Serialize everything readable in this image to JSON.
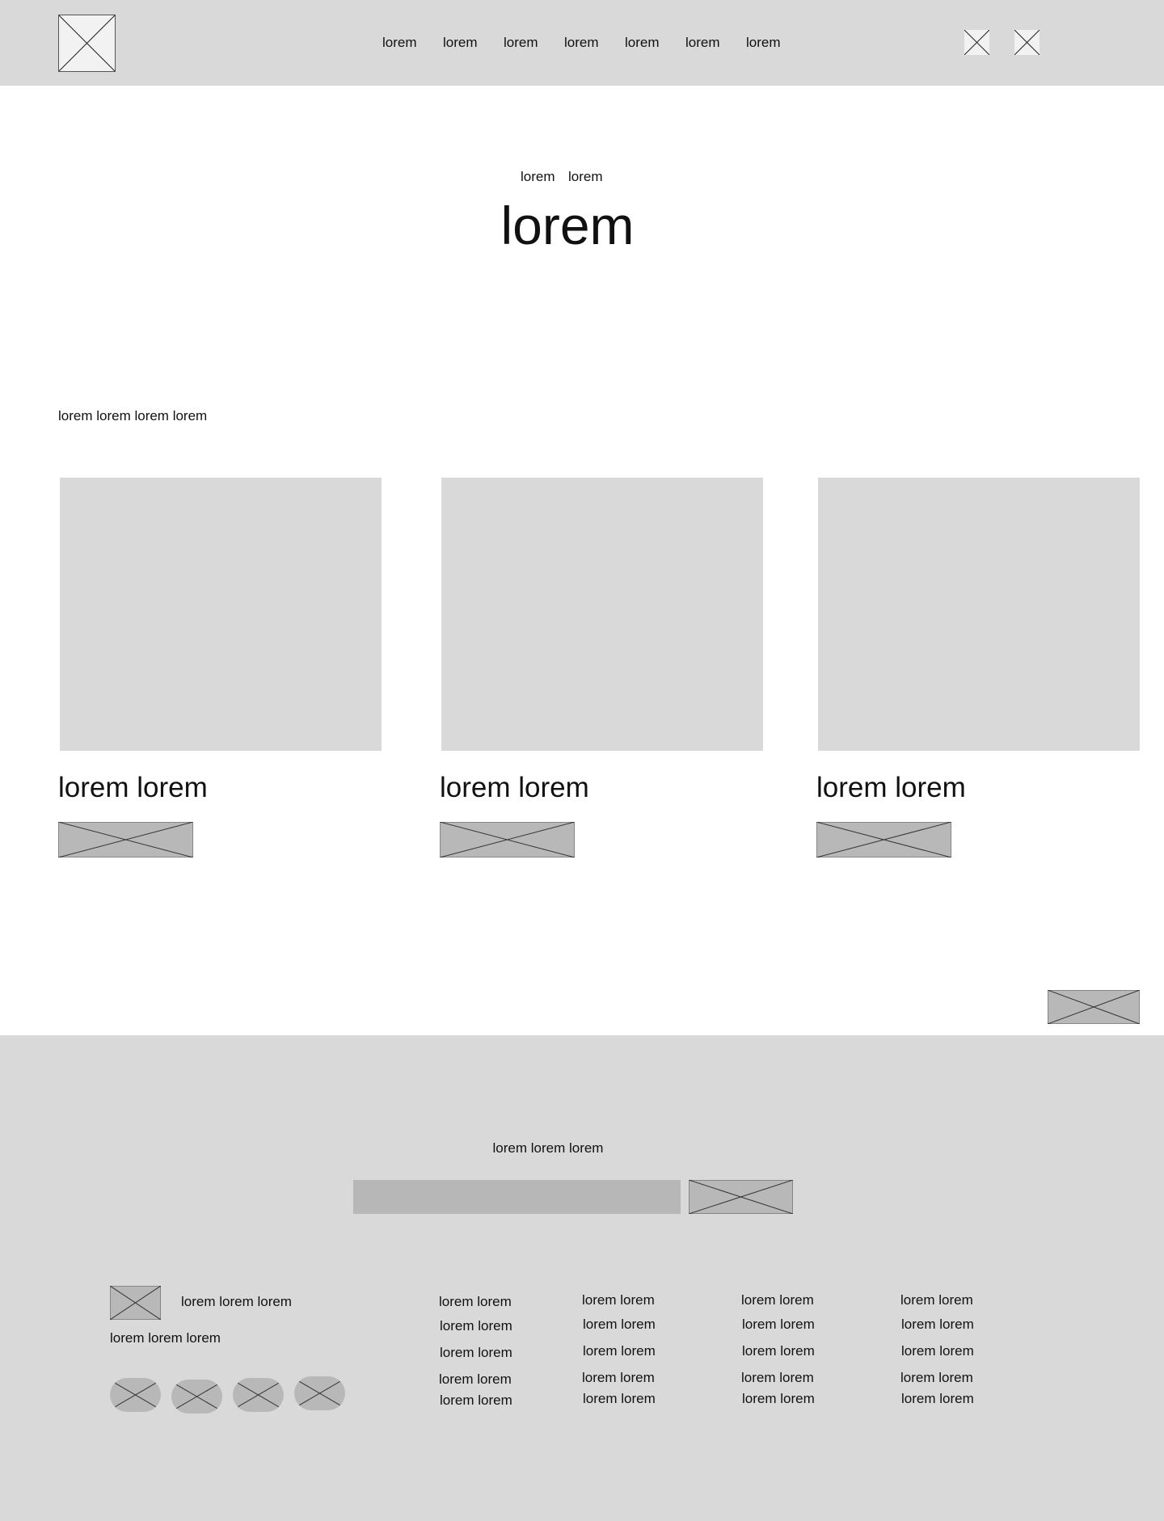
{
  "header": {
    "nav": [
      "lorem",
      "lorem",
      "lorem",
      "lorem",
      "lorem",
      "lorem",
      "lorem"
    ]
  },
  "hero": {
    "breadcrumb": [
      "lorem",
      "lorem"
    ],
    "title": "lorem"
  },
  "section": {
    "label": "lorem lorem lorem lorem",
    "cards": [
      {
        "title": "lorem lorem"
      },
      {
        "title": "lorem lorem"
      },
      {
        "title": "lorem lorem"
      }
    ]
  },
  "footer": {
    "newsletter_text": "lorem lorem lorem",
    "email_value": "",
    "brand_text": "lorem lorem lorem",
    "tagline": "lorem lorem lorem",
    "columns": [
      [
        "lorem lorem",
        "lorem lorem",
        "lorem lorem",
        "lorem lorem",
        "lorem lorem"
      ],
      [
        "lorem lorem",
        "lorem lorem",
        "lorem lorem",
        "lorem lorem",
        "lorem lorem"
      ],
      [
        "lorem lorem",
        "lorem lorem",
        "lorem lorem",
        "lorem lorem",
        "lorem lorem"
      ],
      [
        "lorem lorem",
        "lorem lorem",
        "lorem lorem",
        "lorem lorem",
        "lorem lorem"
      ]
    ]
  },
  "colors": {
    "header_bg": "#d9d9d9",
    "footer_bg": "#d9d9d9",
    "placeholder_fill": "#b8b8b8",
    "logo_fill": "#f2f2f2",
    "text": "#111111"
  }
}
